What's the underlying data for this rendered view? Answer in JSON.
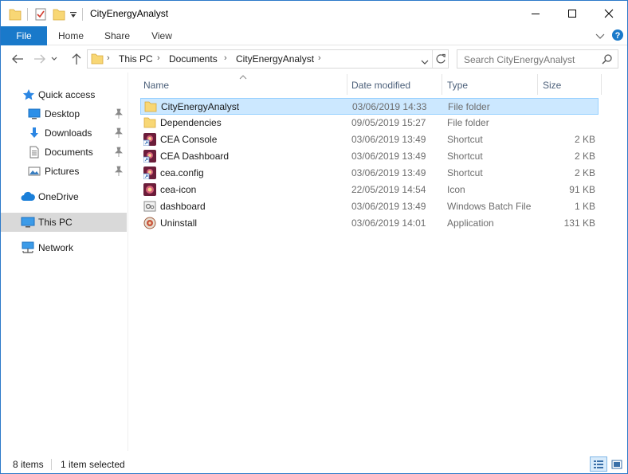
{
  "window": {
    "title": "CityEnergyAnalyst",
    "accent": "#1979ca",
    "controls": [
      "minimize",
      "maximize",
      "close"
    ]
  },
  "ribbon": {
    "tabs": [
      {
        "label": "File"
      },
      {
        "label": "Home"
      },
      {
        "label": "Share"
      },
      {
        "label": "View"
      }
    ]
  },
  "address": {
    "crumbs": [
      "This PC",
      "Documents",
      "CityEnergyAnalyst"
    ],
    "search_placeholder": "Search CityEnergyAnalyst"
  },
  "navpane": {
    "items": [
      {
        "label": "Quick access",
        "icon": "star-icon"
      },
      {
        "label": "Desktop",
        "icon": "desktop-icon",
        "pinned": true
      },
      {
        "label": "Downloads",
        "icon": "download-icon",
        "pinned": true
      },
      {
        "label": "Documents",
        "icon": "documents-icon",
        "pinned": true
      },
      {
        "label": "Pictures",
        "icon": "pictures-icon",
        "pinned": true
      },
      {
        "label": "OneDrive",
        "icon": "cloud-icon"
      },
      {
        "label": "This PC",
        "icon": "computer-icon",
        "selected": true
      },
      {
        "label": "Network",
        "icon": "network-icon"
      }
    ]
  },
  "filelist": {
    "columns": {
      "name": "Name",
      "date": "Date modified",
      "type": "Type",
      "size": "Size"
    },
    "rows": [
      {
        "name": "CityEnergyAnalyst",
        "date": "03/06/2019 14:33",
        "type": "File folder",
        "size": "",
        "icon": "folder-icon",
        "selected": true
      },
      {
        "name": "Dependencies",
        "date": "09/05/2019 15:27",
        "type": "File folder",
        "size": "",
        "icon": "folder-icon"
      },
      {
        "name": "CEA Console",
        "date": "03/06/2019 13:49",
        "type": "Shortcut",
        "size": "2 KB",
        "icon": "cea-shortcut-icon"
      },
      {
        "name": "CEA Dashboard",
        "date": "03/06/2019 13:49",
        "type": "Shortcut",
        "size": "2 KB",
        "icon": "cea-shortcut-icon"
      },
      {
        "name": "cea.config",
        "date": "03/06/2019 13:49",
        "type": "Shortcut",
        "size": "2 KB",
        "icon": "cea-shortcut-icon"
      },
      {
        "name": "cea-icon",
        "date": "22/05/2019 14:54",
        "type": "Icon",
        "size": "91 KB",
        "icon": "cea-icon"
      },
      {
        "name": "dashboard",
        "date": "03/06/2019 13:49",
        "type": "Windows Batch File",
        "size": "1 KB",
        "icon": "batch-file-icon"
      },
      {
        "name": "Uninstall",
        "date": "03/06/2019 14:01",
        "type": "Application",
        "size": "131 KB",
        "icon": "uninstall-icon"
      }
    ]
  },
  "status": {
    "item_count": "8 items",
    "selected": "1 item selected"
  }
}
